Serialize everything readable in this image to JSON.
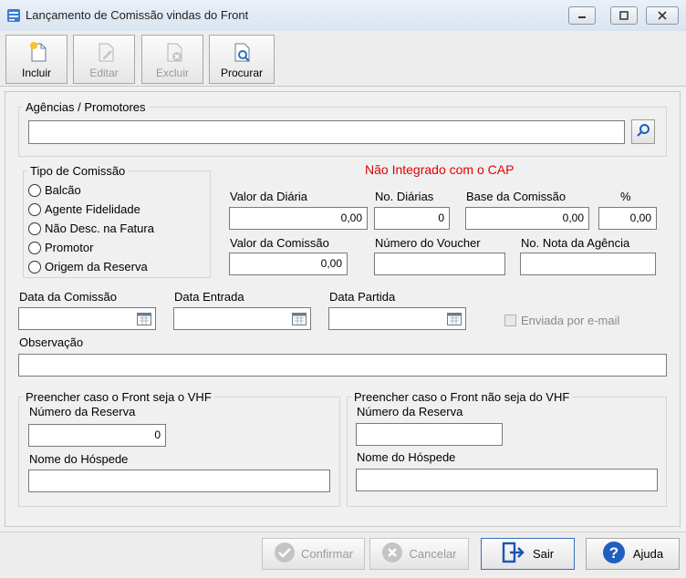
{
  "window": {
    "title": "Lançamento de Comissão vindas do Front"
  },
  "toolbar": {
    "incluir": "Incluir",
    "editar": "Editar",
    "excluir": "Excluir",
    "procurar": "Procurar"
  },
  "agencias": {
    "legend": "Agências  / Promotores",
    "value": ""
  },
  "tipo_comissao": {
    "legend": "Tipo de Comissão",
    "options": [
      "Balcão",
      "Agente Fidelidade",
      "Não Desc. na Fatura",
      "Promotor",
      "Origem da Reserva"
    ]
  },
  "status": "Não Integrado com o CAP",
  "valores": {
    "valor_diaria_label": "Valor da Diária",
    "valor_diaria": "0,00",
    "no_diarias_label": "No. Diárias",
    "no_diarias": "0",
    "base_comissao_label": "Base da Comissão",
    "base_comissao": "0,00",
    "pct_label": "%",
    "pct": "0,00",
    "valor_comissao_label": "Valor da Comissão",
    "valor_comissao": "0,00",
    "numero_voucher_label": "Número do Voucher",
    "numero_voucher": "",
    "no_nota_label": "No. Nota da Agência",
    "no_nota": ""
  },
  "datas": {
    "data_comissao_label": "Data da Comissão",
    "data_entrada_label": "Data Entrada",
    "data_partida_label": "Data Partida",
    "enviada_email": "Enviada por e-mail"
  },
  "observacao": {
    "label": "Observação",
    "value": ""
  },
  "front_vhf": {
    "legend": "Preencher caso o Front seja o VHF",
    "numero_reserva_label": "Número da Reserva",
    "numero_reserva": "0",
    "nome_hospede_label": "Nome do Hóspede",
    "nome_hospede": ""
  },
  "front_nao_vhf": {
    "legend": "Preencher caso o Front não seja do VHF",
    "numero_reserva_label": "Número da Reserva",
    "numero_reserva": "",
    "nome_hospede_label": "Nome do Hóspede",
    "nome_hospede": ""
  },
  "buttons": {
    "confirmar": "Confirmar",
    "cancelar": "Cancelar",
    "sair": "Sair",
    "ajuda": "Ajuda"
  },
  "colors": {
    "status_red": "#e00000",
    "help_blue": "#1f5fbf",
    "exit_blue": "#1a56b0"
  }
}
